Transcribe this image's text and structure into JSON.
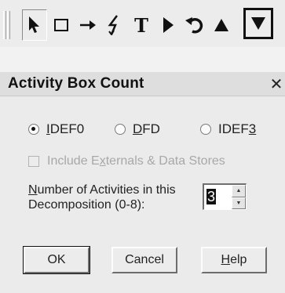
{
  "toolbar": {
    "tools": [
      {
        "name": "pointer",
        "icon": "cursor-arrow-icon"
      },
      {
        "name": "box",
        "icon": "box-icon"
      },
      {
        "name": "arrow",
        "icon": "arrow-right-icon"
      },
      {
        "name": "squiggle",
        "icon": "lightning-icon"
      },
      {
        "name": "text",
        "icon": "text-icon",
        "glyph": "T"
      },
      {
        "name": "triangle-right",
        "icon": "triangle-right-icon"
      },
      {
        "name": "undo",
        "icon": "undo-icon"
      },
      {
        "name": "triangle-up",
        "icon": "triangle-up-icon"
      },
      {
        "name": "triangle-down",
        "icon": "triangle-down-icon",
        "selected": true
      }
    ]
  },
  "dialog": {
    "title": "Activity Box Count",
    "close_glyph": "✕",
    "radios": [
      {
        "prefix": "",
        "mnemonic": "I",
        "rest": "DEF0",
        "checked": true
      },
      {
        "prefix": "",
        "mnemonic": "D",
        "rest": "FD",
        "checked": false
      },
      {
        "prefix": "IDEF",
        "mnemonic": "3",
        "rest": "",
        "checked": false
      }
    ],
    "include_checkbox": {
      "prefix": "Include E",
      "mnemonic": "x",
      "rest": "ternals & Data Stores",
      "checked": false,
      "enabled": false
    },
    "activities": {
      "label_line1_mnemonic": "N",
      "label_line1_rest": "umber of Activities in this",
      "label_line2": "Decomposition (0-8):",
      "value": "3"
    },
    "buttons": {
      "ok": "OK",
      "cancel": "Cancel",
      "help_mnemonic": "H",
      "help_rest": "elp"
    }
  }
}
